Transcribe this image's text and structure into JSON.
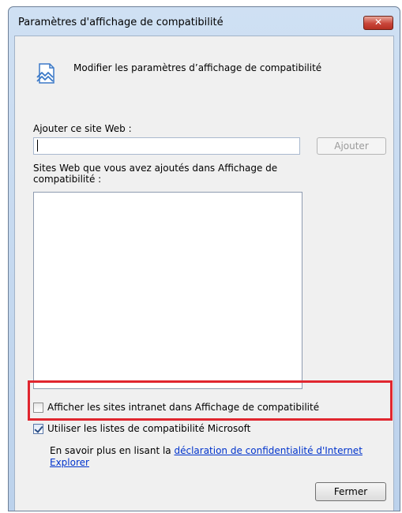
{
  "dialog": {
    "title": "Paramètres d'affichage de compatibilité",
    "close_glyph": "✕",
    "header": "Modifier les paramètres d’affichage de compatibilité",
    "header_icon": "compatibility-view-icon"
  },
  "add_site": {
    "label": "Ajouter ce site Web :",
    "value": "",
    "button": "Ajouter"
  },
  "sites": {
    "label": "Sites Web que vous avez ajoutés dans Affichage de compatibilité :",
    "items": []
  },
  "options": {
    "intranet": {
      "label": "Afficher les sites intranet dans Affichage de compatibilité",
      "checked": false
    },
    "microsoft_lists": {
      "label": "Utiliser les listes de compatibilité Microsoft",
      "checked": true
    }
  },
  "privacy": {
    "prefix": "En savoir plus en lisant la ",
    "link": "déclaration de confidentialité d'Internet Explorer"
  },
  "footer": {
    "close_button": "Fermer"
  },
  "colors": {
    "highlight": "#e0262f",
    "link": "#0033cc",
    "title_bar": "#cfe0f3"
  }
}
